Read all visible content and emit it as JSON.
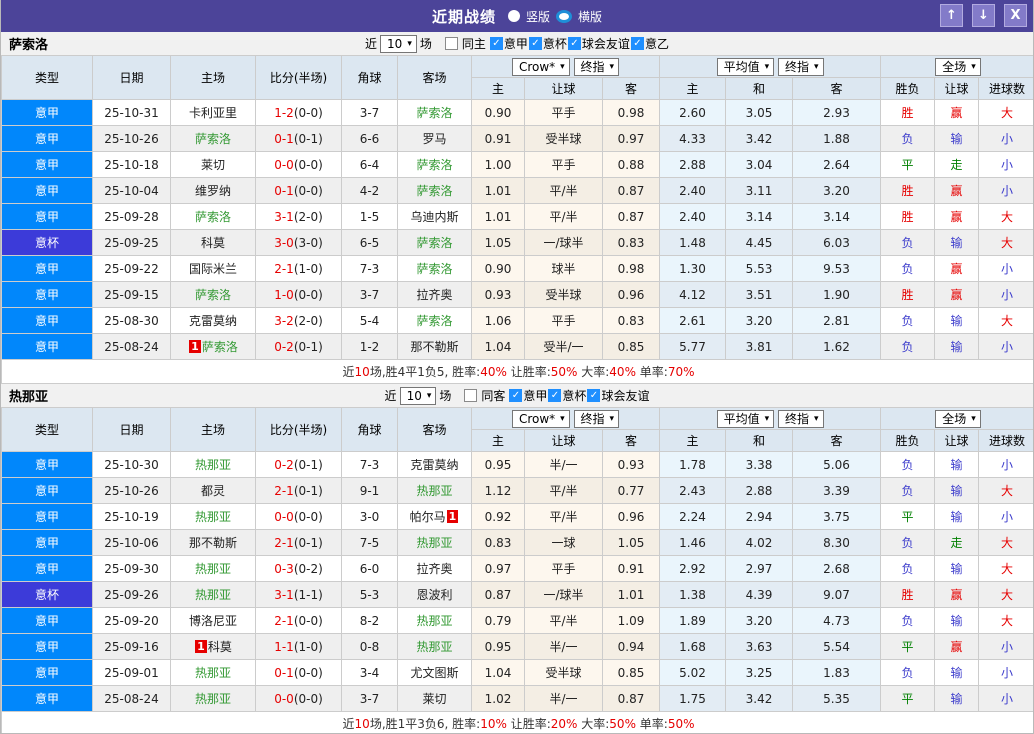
{
  "header": {
    "title": "近期战绩",
    "radio_vertical_label": "竖版",
    "radio_horizontal_label": "横版",
    "up_button": "↑",
    "down_button": "↓",
    "close_button": "X"
  },
  "ui": {
    "near_label": "近",
    "games_label": "场"
  },
  "table_header": {
    "cols": [
      "类型",
      "日期",
      "主场",
      "比分(半场)",
      "角球",
      "客场"
    ],
    "sub": [
      "主",
      "让球",
      "客",
      "主",
      "和",
      "客",
      "胜负",
      "让球",
      "进球数"
    ],
    "selects": {
      "odds_source": "Crow*",
      "final1": "终指",
      "average": "平均值",
      "final2": "终指",
      "scope": "全场"
    }
  },
  "colors": {
    "titlebar": "#4c4499",
    "league": {
      "意甲": "#0187fb",
      "意杯": "#3c3bd9"
    },
    "result": {
      "win": "#e60000",
      "loss": "#3c3ccc",
      "draw": "#008000"
    },
    "team_highlight": "#339933",
    "score": "#e60000",
    "summary_red": "#e60000"
  },
  "sections": [
    {
      "team": "萨索洛",
      "filter": {
        "count": "10",
        "same_label": "同主",
        "same_checked": false,
        "leagues": [
          {
            "label": "意甲",
            "checked": true
          },
          {
            "label": "意杯",
            "checked": true
          },
          {
            "label": "球会友谊",
            "checked": true
          },
          {
            "label": "意乙",
            "checked": true
          }
        ]
      },
      "rows": [
        {
          "league": "意甲",
          "date": "25-10-31",
          "home": {
            "name": "卡利亚里",
            "hl": false
          },
          "score": {
            "ft": "1-2",
            "ht": "(0-0)"
          },
          "corner": "3-7",
          "away": {
            "name": "萨索洛",
            "hl": true
          },
          "odds": [
            "0.90",
            "平手",
            "0.98"
          ],
          "avg": [
            "2.60",
            "3.05",
            "2.93"
          ],
          "results": [
            [
              "胜",
              "win"
            ],
            [
              "赢",
              "win"
            ],
            [
              "大",
              "win"
            ]
          ]
        },
        {
          "league": "意甲",
          "date": "25-10-26",
          "home": {
            "name": "萨索洛",
            "hl": true
          },
          "score": {
            "ft": "0-1",
            "ht": "(0-1)"
          },
          "corner": "6-6",
          "away": {
            "name": "罗马",
            "hl": false
          },
          "odds": [
            "0.91",
            "受半球",
            "0.97"
          ],
          "avg": [
            "4.33",
            "3.42",
            "1.88"
          ],
          "results": [
            [
              "负",
              "loss"
            ],
            [
              "输",
              "loss"
            ],
            [
              "小",
              "loss"
            ]
          ]
        },
        {
          "league": "意甲",
          "date": "25-10-18",
          "home": {
            "name": "莱切",
            "hl": false
          },
          "score": {
            "ft": "0-0",
            "ht": "(0-0)"
          },
          "corner": "6-4",
          "away": {
            "name": "萨索洛",
            "hl": true
          },
          "odds": [
            "1.00",
            "平手",
            "0.88"
          ],
          "avg": [
            "2.88",
            "3.04",
            "2.64"
          ],
          "results": [
            [
              "平",
              "draw"
            ],
            [
              "走",
              "draw"
            ],
            [
              "小",
              "loss"
            ]
          ]
        },
        {
          "league": "意甲",
          "date": "25-10-04",
          "home": {
            "name": "维罗纳",
            "hl": false
          },
          "score": {
            "ft": "0-1",
            "ht": "(0-0)"
          },
          "corner": "4-2",
          "away": {
            "name": "萨索洛",
            "hl": true
          },
          "odds": [
            "1.01",
            "平/半",
            "0.87"
          ],
          "avg": [
            "2.40",
            "3.11",
            "3.20"
          ],
          "results": [
            [
              "胜",
              "win"
            ],
            [
              "赢",
              "win"
            ],
            [
              "小",
              "loss"
            ]
          ]
        },
        {
          "league": "意甲",
          "date": "25-09-28",
          "home": {
            "name": "萨索洛",
            "hl": true
          },
          "score": {
            "ft": "3-1",
            "ht": "(2-0)"
          },
          "corner": "1-5",
          "away": {
            "name": "乌迪内斯",
            "hl": false
          },
          "odds": [
            "1.01",
            "平/半",
            "0.87"
          ],
          "avg": [
            "2.40",
            "3.14",
            "3.14"
          ],
          "results": [
            [
              "胜",
              "win"
            ],
            [
              "赢",
              "win"
            ],
            [
              "大",
              "win"
            ]
          ]
        },
        {
          "league": "意杯",
          "date": "25-09-25",
          "home": {
            "name": "科莫",
            "hl": false
          },
          "score": {
            "ft": "3-0",
            "ht": "(3-0)"
          },
          "corner": "6-5",
          "away": {
            "name": "萨索洛",
            "hl": true
          },
          "odds": [
            "1.05",
            "一/球半",
            "0.83"
          ],
          "avg": [
            "1.48",
            "4.45",
            "6.03"
          ],
          "results": [
            [
              "负",
              "loss"
            ],
            [
              "输",
              "loss"
            ],
            [
              "大",
              "win"
            ]
          ]
        },
        {
          "league": "意甲",
          "date": "25-09-22",
          "home": {
            "name": "国际米兰",
            "hl": false
          },
          "score": {
            "ft": "2-1",
            "ht": "(1-0)"
          },
          "corner": "7-3",
          "away": {
            "name": "萨索洛",
            "hl": true
          },
          "odds": [
            "0.90",
            "球半",
            "0.98"
          ],
          "avg": [
            "1.30",
            "5.53",
            "9.53"
          ],
          "results": [
            [
              "负",
              "loss"
            ],
            [
              "赢",
              "win"
            ],
            [
              "小",
              "loss"
            ]
          ]
        },
        {
          "league": "意甲",
          "date": "25-09-15",
          "home": {
            "name": "萨索洛",
            "hl": true
          },
          "score": {
            "ft": "1-0",
            "ht": "(0-0)"
          },
          "corner": "3-7",
          "away": {
            "name": "拉齐奥",
            "hl": false
          },
          "odds": [
            "0.93",
            "受半球",
            "0.96"
          ],
          "avg": [
            "4.12",
            "3.51",
            "1.90"
          ],
          "results": [
            [
              "胜",
              "win"
            ],
            [
              "赢",
              "win"
            ],
            [
              "小",
              "loss"
            ]
          ]
        },
        {
          "league": "意甲",
          "date": "25-08-30",
          "home": {
            "name": "克雷莫纳",
            "hl": false
          },
          "score": {
            "ft": "3-2",
            "ht": "(2-0)"
          },
          "corner": "5-4",
          "away": {
            "name": "萨索洛",
            "hl": true
          },
          "odds": [
            "1.06",
            "平手",
            "0.83"
          ],
          "avg": [
            "2.61",
            "3.20",
            "2.81"
          ],
          "results": [
            [
              "负",
              "loss"
            ],
            [
              "输",
              "loss"
            ],
            [
              "大",
              "win"
            ]
          ]
        },
        {
          "league": "意甲",
          "date": "25-08-24",
          "home": {
            "name": "萨索洛",
            "hl": true,
            "badge": "1",
            "badge_pos": "before"
          },
          "score": {
            "ft": "0-2",
            "ht": "(0-1)"
          },
          "corner": "1-2",
          "away": {
            "name": "那不勒斯",
            "hl": false
          },
          "odds": [
            "1.04",
            "受半/一",
            "0.85"
          ],
          "avg": [
            "5.77",
            "3.81",
            "1.62"
          ],
          "results": [
            [
              "负",
              "loss"
            ],
            [
              "输",
              "loss"
            ],
            [
              "小",
              "loss"
            ]
          ]
        }
      ],
      "summary": [
        [
          "近",
          "k"
        ],
        [
          "10",
          "r"
        ],
        [
          "场,胜4平1负5, 胜率:",
          "k"
        ],
        [
          "40%",
          "r"
        ],
        [
          " 让胜率:",
          "k"
        ],
        [
          "50%",
          "r"
        ],
        [
          " 大率:",
          "k"
        ],
        [
          "40%",
          "r"
        ],
        [
          " 单率:",
          "k"
        ],
        [
          "70%",
          "r"
        ]
      ]
    },
    {
      "team": "热那亚",
      "filter": {
        "count": "10",
        "same_label": "同客",
        "same_checked": false,
        "leagues": [
          {
            "label": "意甲",
            "checked": true
          },
          {
            "label": "意杯",
            "checked": true
          },
          {
            "label": "球会友谊",
            "checked": true
          }
        ]
      },
      "rows": [
        {
          "league": "意甲",
          "date": "25-10-30",
          "home": {
            "name": "热那亚",
            "hl": true
          },
          "score": {
            "ft": "0-2",
            "ht": "(0-1)"
          },
          "corner": "7-3",
          "away": {
            "name": "克雷莫纳",
            "hl": false
          },
          "odds": [
            "0.95",
            "半/一",
            "0.93"
          ],
          "avg": [
            "1.78",
            "3.38",
            "5.06"
          ],
          "results": [
            [
              "负",
              "loss"
            ],
            [
              "输",
              "loss"
            ],
            [
              "小",
              "loss"
            ]
          ]
        },
        {
          "league": "意甲",
          "date": "25-10-26",
          "home": {
            "name": "都灵",
            "hl": false
          },
          "score": {
            "ft": "2-1",
            "ht": "(0-1)"
          },
          "corner": "9-1",
          "away": {
            "name": "热那亚",
            "hl": true
          },
          "odds": [
            "1.12",
            "平/半",
            "0.77"
          ],
          "avg": [
            "2.43",
            "2.88",
            "3.39"
          ],
          "results": [
            [
              "负",
              "loss"
            ],
            [
              "输",
              "loss"
            ],
            [
              "大",
              "win"
            ]
          ]
        },
        {
          "league": "意甲",
          "date": "25-10-19",
          "home": {
            "name": "热那亚",
            "hl": true
          },
          "score": {
            "ft": "0-0",
            "ht": "(0-0)"
          },
          "corner": "3-0",
          "away": {
            "name": "帕尔马",
            "hl": false,
            "badge": "1",
            "badge_pos": "after"
          },
          "odds": [
            "0.92",
            "平/半",
            "0.96"
          ],
          "avg": [
            "2.24",
            "2.94",
            "3.75"
          ],
          "results": [
            [
              "平",
              "draw"
            ],
            [
              "输",
              "loss"
            ],
            [
              "小",
              "loss"
            ]
          ]
        },
        {
          "league": "意甲",
          "date": "25-10-06",
          "home": {
            "name": "那不勒斯",
            "hl": false
          },
          "score": {
            "ft": "2-1",
            "ht": "(0-1)"
          },
          "corner": "7-5",
          "away": {
            "name": "热那亚",
            "hl": true
          },
          "odds": [
            "0.83",
            "一球",
            "1.05"
          ],
          "avg": [
            "1.46",
            "4.02",
            "8.30"
          ],
          "results": [
            [
              "负",
              "loss"
            ],
            [
              "走",
              "draw"
            ],
            [
              "大",
              "win"
            ]
          ]
        },
        {
          "league": "意甲",
          "date": "25-09-30",
          "home": {
            "name": "热那亚",
            "hl": true
          },
          "score": {
            "ft": "0-3",
            "ht": "(0-2)"
          },
          "corner": "6-0",
          "away": {
            "name": "拉齐奥",
            "hl": false
          },
          "odds": [
            "0.97",
            "平手",
            "0.91"
          ],
          "avg": [
            "2.92",
            "2.97",
            "2.68"
          ],
          "results": [
            [
              "负",
              "loss"
            ],
            [
              "输",
              "loss"
            ],
            [
              "大",
              "win"
            ]
          ]
        },
        {
          "league": "意杯",
          "date": "25-09-26",
          "home": {
            "name": "热那亚",
            "hl": true
          },
          "score": {
            "ft": "3-1",
            "ht": "(1-1)"
          },
          "corner": "5-3",
          "away": {
            "name": "恩波利",
            "hl": false
          },
          "odds": [
            "0.87",
            "一/球半",
            "1.01"
          ],
          "avg": [
            "1.38",
            "4.39",
            "9.07"
          ],
          "results": [
            [
              "胜",
              "win"
            ],
            [
              "赢",
              "win"
            ],
            [
              "大",
              "win"
            ]
          ]
        },
        {
          "league": "意甲",
          "date": "25-09-20",
          "home": {
            "name": "博洛尼亚",
            "hl": false
          },
          "score": {
            "ft": "2-1",
            "ht": "(0-0)"
          },
          "corner": "8-2",
          "away": {
            "name": "热那亚",
            "hl": true
          },
          "odds": [
            "0.79",
            "平/半",
            "1.09"
          ],
          "avg": [
            "1.89",
            "3.20",
            "4.73"
          ],
          "results": [
            [
              "负",
              "loss"
            ],
            [
              "输",
              "loss"
            ],
            [
              "大",
              "win"
            ]
          ]
        },
        {
          "league": "意甲",
          "date": "25-09-16",
          "home": {
            "name": "科莫",
            "hl": false,
            "badge": "1",
            "badge_pos": "before"
          },
          "score": {
            "ft": "1-1",
            "ht": "(1-0)"
          },
          "corner": "0-8",
          "away": {
            "name": "热那亚",
            "hl": true
          },
          "odds": [
            "0.95",
            "半/一",
            "0.94"
          ],
          "avg": [
            "1.68",
            "3.63",
            "5.54"
          ],
          "results": [
            [
              "平",
              "draw"
            ],
            [
              "赢",
              "win"
            ],
            [
              "小",
              "loss"
            ]
          ]
        },
        {
          "league": "意甲",
          "date": "25-09-01",
          "home": {
            "name": "热那亚",
            "hl": true
          },
          "score": {
            "ft": "0-1",
            "ht": "(0-0)"
          },
          "corner": "3-4",
          "away": {
            "name": "尤文图斯",
            "hl": false
          },
          "odds": [
            "1.04",
            "受半球",
            "0.85"
          ],
          "avg": [
            "5.02",
            "3.25",
            "1.83"
          ],
          "results": [
            [
              "负",
              "loss"
            ],
            [
              "输",
              "loss"
            ],
            [
              "小",
              "loss"
            ]
          ]
        },
        {
          "league": "意甲",
          "date": "25-08-24",
          "home": {
            "name": "热那亚",
            "hl": true
          },
          "score": {
            "ft": "0-0",
            "ht": "(0-0)"
          },
          "corner": "3-7",
          "away": {
            "name": "莱切",
            "hl": false
          },
          "odds": [
            "1.02",
            "半/一",
            "0.87"
          ],
          "avg": [
            "1.75",
            "3.42",
            "5.35"
          ],
          "results": [
            [
              "平",
              "draw"
            ],
            [
              "输",
              "loss"
            ],
            [
              "小",
              "loss"
            ]
          ]
        }
      ],
      "summary": [
        [
          "近",
          "k"
        ],
        [
          "10",
          "r"
        ],
        [
          "场,胜1平3负6, 胜率:",
          "k"
        ],
        [
          "10%",
          "r"
        ],
        [
          " 让胜率:",
          "k"
        ],
        [
          "20%",
          "r"
        ],
        [
          " 大率:",
          "k"
        ],
        [
          "50%",
          "r"
        ],
        [
          " 单率:",
          "k"
        ],
        [
          "50%",
          "r"
        ]
      ]
    }
  ]
}
